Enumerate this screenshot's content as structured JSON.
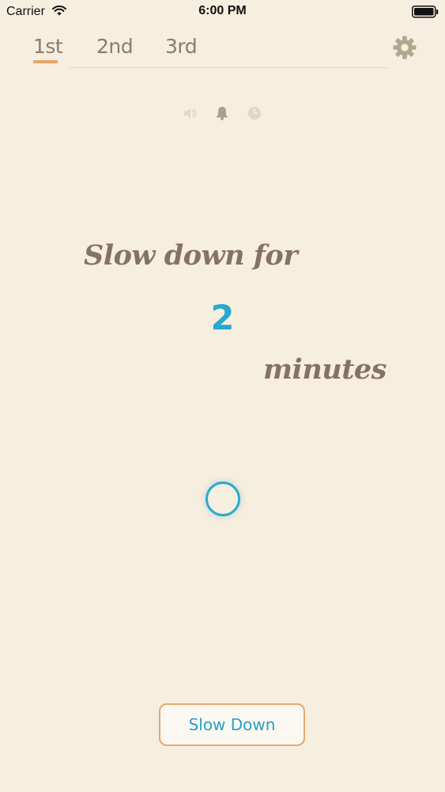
{
  "status_bar": {
    "carrier": "Carrier",
    "time": "6:00 PM",
    "wifi_icon": "wifi-icon",
    "battery_icon": "battery-icon"
  },
  "tabs": [
    {
      "label": "1st",
      "selected": true
    },
    {
      "label": "2nd",
      "selected": false
    },
    {
      "label": "3rd",
      "selected": false
    }
  ],
  "settings_icon": "gear-icon",
  "mode_icons": [
    "speaker-icon",
    "bell-icon",
    "clock-icon"
  ],
  "message": {
    "prefix": "Slow down for",
    "number": "2",
    "suffix": "minutes"
  },
  "action_button": {
    "label": "Slow Down"
  },
  "colors": {
    "background": "#f6eedf",
    "accent_orange": "#e5a56a",
    "accent_blue": "#27a9cf",
    "text_brown": "#847364",
    "icon_tan": "#b6a891"
  }
}
